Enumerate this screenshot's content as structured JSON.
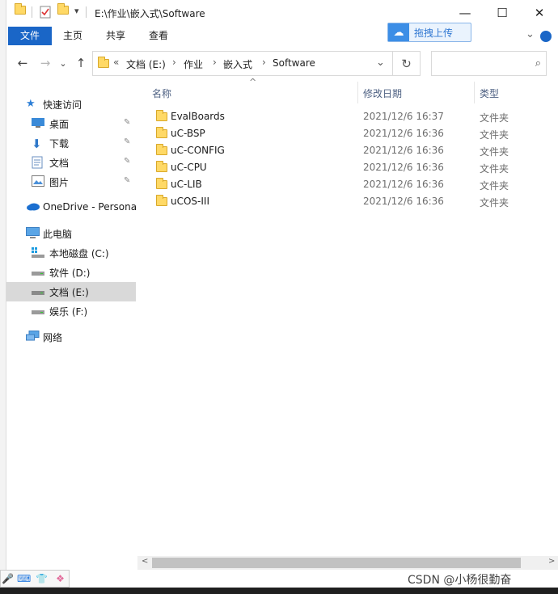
{
  "window": {
    "title_path": "E:\\作业\\嵌入式\\Software",
    "minimize_glyph": "—",
    "maximize_glyph": "☐",
    "close_glyph": "✕"
  },
  "ribbon": {
    "tabs": [
      "文件",
      "主页",
      "共享",
      "查看"
    ],
    "cloud_button_label": "拖拽上传",
    "expand_glyph": "⌄"
  },
  "address": {
    "overflow": "«",
    "segments": [
      "文档 (E:)",
      "作业",
      "嵌入式",
      "Software"
    ],
    "separator": "›",
    "dropdown_glyph": "⌄",
    "refresh_glyph": "↻",
    "search_placeholder": "",
    "search_icon_glyph": "⌕"
  },
  "nav_buttons": {
    "back": "←",
    "forward": "→",
    "recent": "⌄",
    "up": "↑"
  },
  "nav_pane": {
    "quick_access": "快速访问",
    "items_quick": [
      {
        "label": "桌面",
        "icon": "desktop-icon"
      },
      {
        "label": "下载",
        "icon": "download-icon"
      },
      {
        "label": "文档",
        "icon": "documents-icon"
      },
      {
        "label": "图片",
        "icon": "pictures-icon"
      }
    ],
    "pin_glyph": "📌",
    "onedrive": "OneDrive - Persona",
    "this_pc": "此电脑",
    "drives": [
      {
        "label": "本地磁盘 (C:)",
        "selected": false
      },
      {
        "label": "软件 (D:)",
        "selected": false
      },
      {
        "label": "文档 (E:)",
        "selected": true
      },
      {
        "label": "娱乐 (F:)",
        "selected": false
      }
    ],
    "network": "网络"
  },
  "columns": {
    "name": "名称",
    "date": "修改日期",
    "type": "类型",
    "sort_glyph": "^"
  },
  "files": [
    {
      "name": "EvalBoards",
      "date": "2021/12/6 16:37",
      "type": "文件夹"
    },
    {
      "name": "uC-BSP",
      "date": "2021/12/6 16:36",
      "type": "文件夹"
    },
    {
      "name": "uC-CONFIG",
      "date": "2021/12/6 16:36",
      "type": "文件夹"
    },
    {
      "name": "uC-CPU",
      "date": "2021/12/6 16:36",
      "type": "文件夹"
    },
    {
      "name": "uC-LIB",
      "date": "2021/12/6 16:36",
      "type": "文件夹"
    },
    {
      "name": "uCOS-III",
      "date": "2021/12/6 16:36",
      "type": "文件夹"
    }
  ],
  "scroll": {
    "left_glyph": "<",
    "right_glyph": ">"
  },
  "ime": {
    "mic": "🎤",
    "keyboard": "⌨",
    "skin": "👕",
    "apps": "❖"
  },
  "watermark": "CSDN @小杨很勤奋",
  "colors": {
    "accent": "#1a66c7",
    "folder": "#ffd966",
    "selection": "#d9d9d9"
  }
}
